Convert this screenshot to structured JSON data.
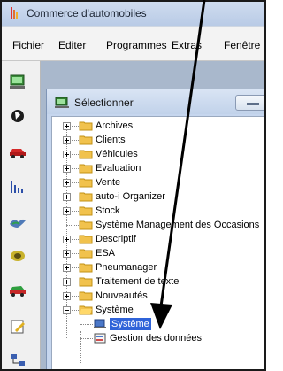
{
  "window": {
    "title": "Commerce d'automobiles",
    "icon": "app-logo-icon"
  },
  "menu": [
    {
      "label": "Fichier"
    },
    {
      "label": "Editer"
    },
    {
      "label": "Programmes"
    },
    {
      "label": "Extras"
    },
    {
      "label": "Fenêtre"
    }
  ],
  "toolbar": {
    "tools": [
      "monitor-tool-icon",
      "globe-tool-icon",
      "car-red-tool-icon",
      "chart-tool-icon",
      "bird-tool-icon",
      "tire-tool-icon",
      "car-green-tool-icon",
      "edit-tool-icon",
      "network-tool-icon"
    ]
  },
  "child_window": {
    "title": "Sélectionner",
    "tree": [
      {
        "label": "Archives"
      },
      {
        "label": "Clients"
      },
      {
        "label": "Véhicules"
      },
      {
        "label": "Evaluation"
      },
      {
        "label": "Vente"
      },
      {
        "label": "auto-i Organizer"
      },
      {
        "label": "Stock"
      },
      {
        "label": "Système Management des Occasions"
      },
      {
        "label": "Descriptif"
      },
      {
        "label": "ESA"
      },
      {
        "label": "Pneumanager"
      },
      {
        "label": "Traitement de texte"
      },
      {
        "label": "Nouveautés"
      },
      {
        "label": "Système"
      },
      {
        "label": "Système"
      },
      {
        "label": "Gestion des données"
      }
    ]
  },
  "colors": {
    "selection": "#2f63d9",
    "arrow": "#000000"
  }
}
